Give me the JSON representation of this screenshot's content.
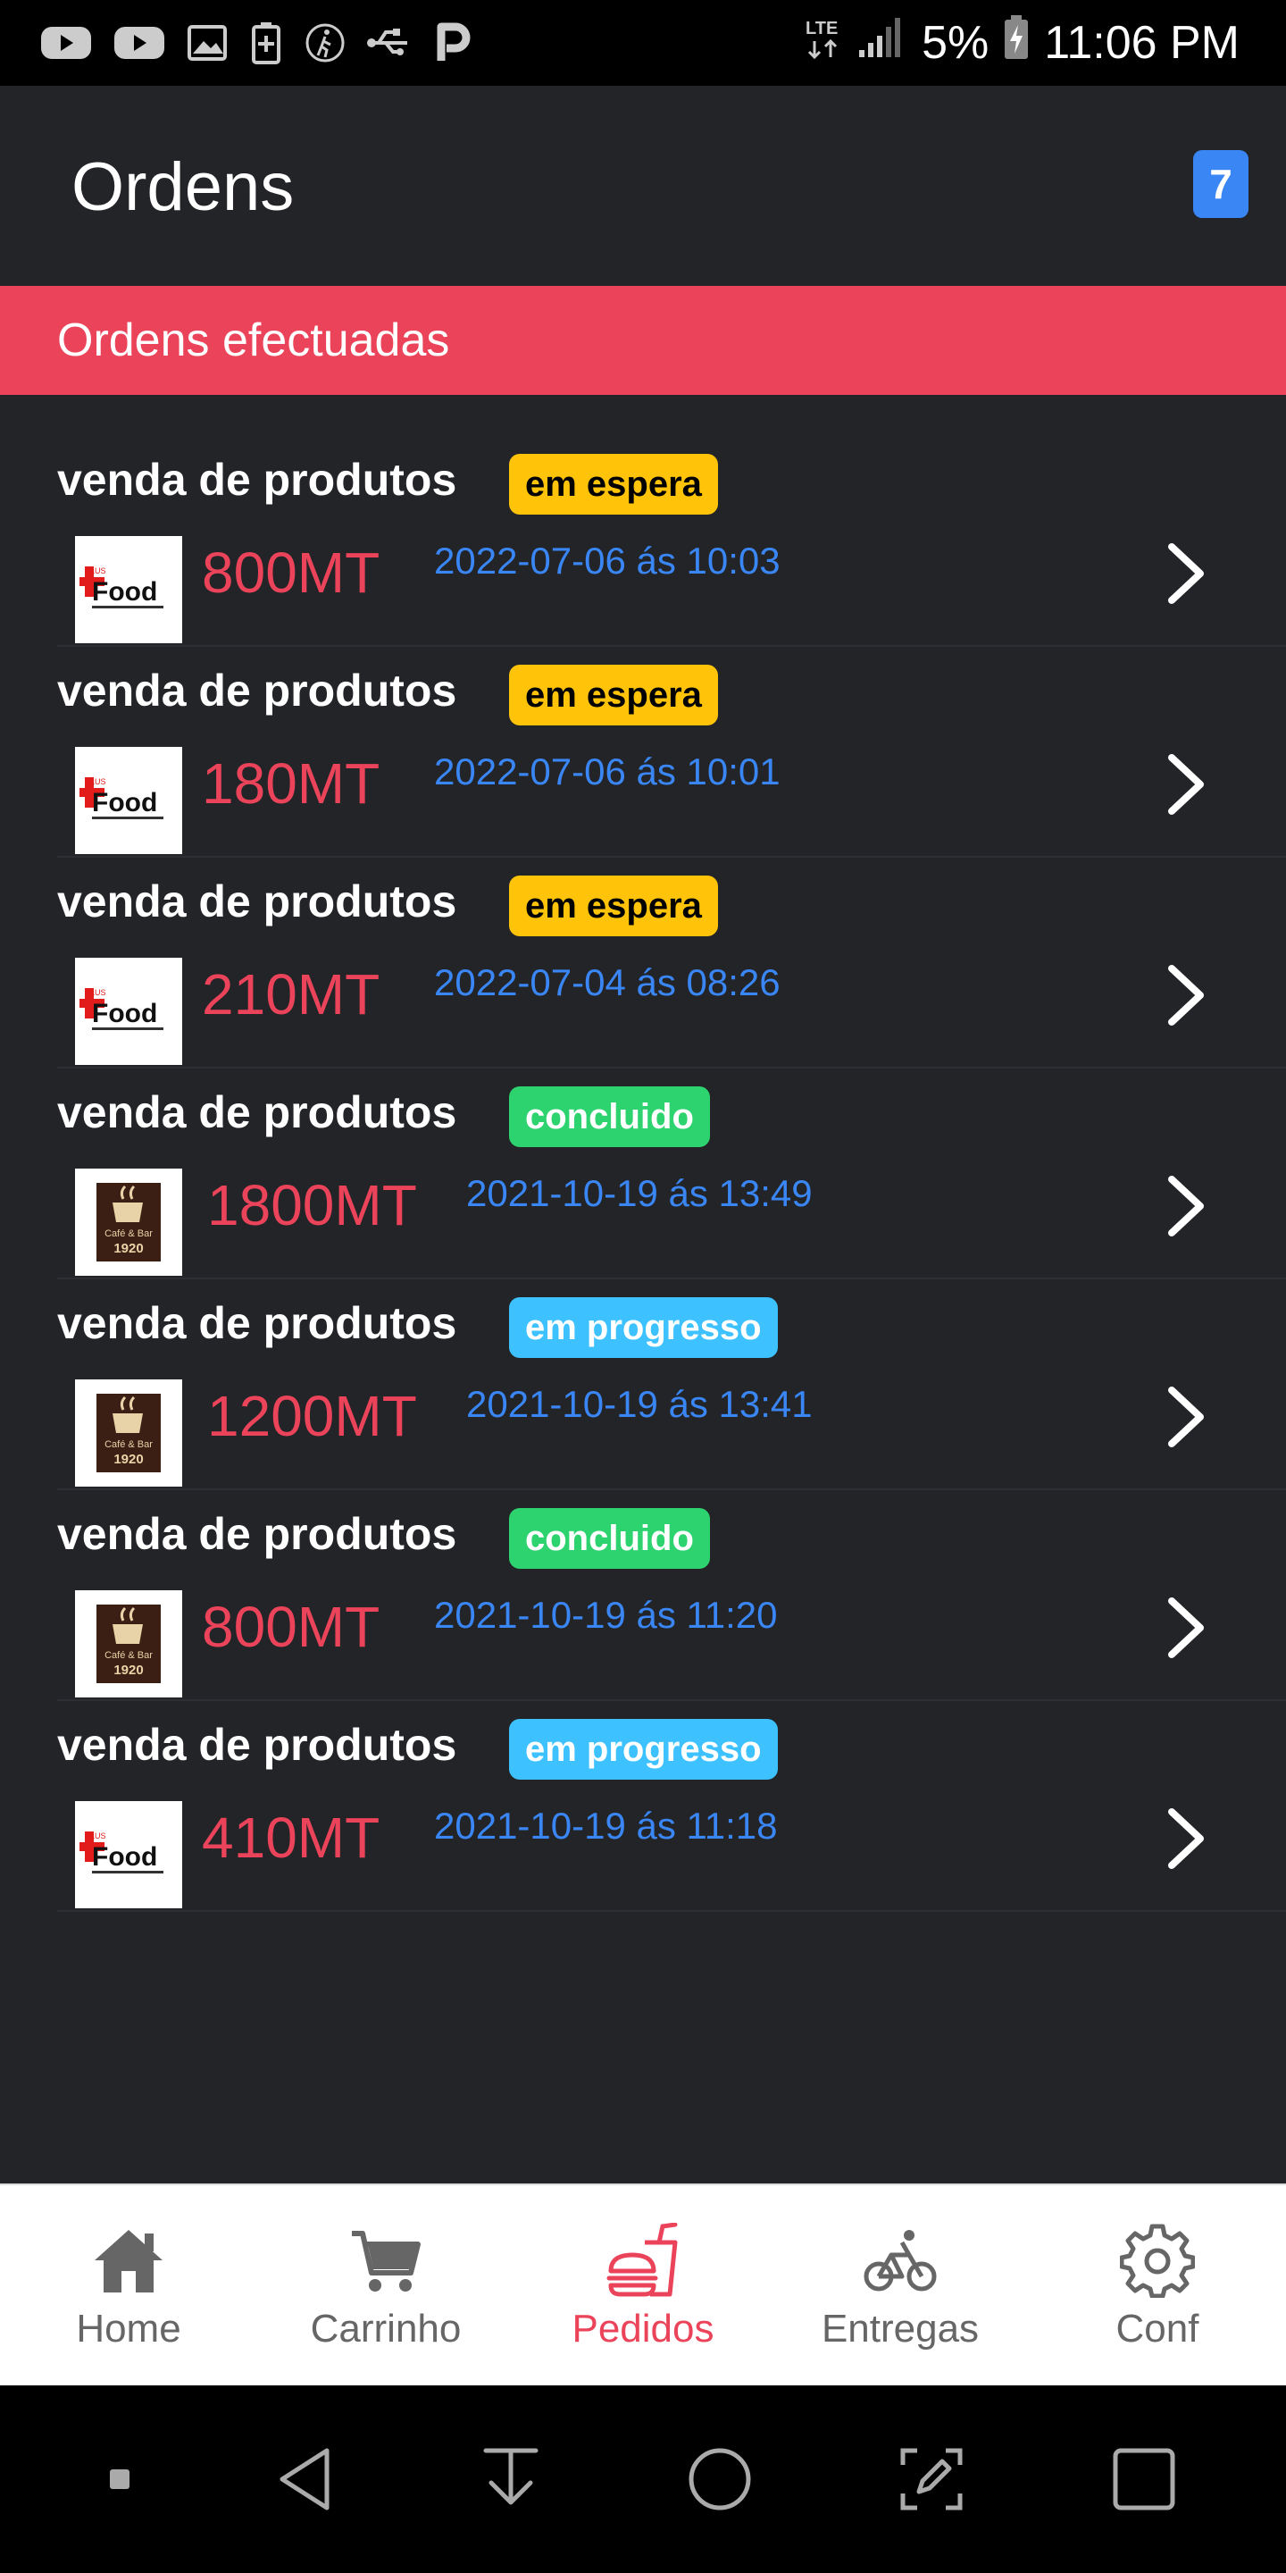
{
  "status_bar": {
    "battery_percent": "5%",
    "time": "11:06 PM",
    "network_label": "LTE",
    "left_icons": [
      "youtube-icon",
      "youtube-icon",
      "image-icon",
      "battery-saver-icon",
      "walk-icon",
      "usb-icon",
      "p-app-icon"
    ]
  },
  "header": {
    "title": "Ordens",
    "badge": "7"
  },
  "section": {
    "title": "Ordens efectuadas"
  },
  "orders": [
    {
      "title": "venda de produtos",
      "status": "em espera",
      "price": "800MT",
      "date": "2022-07-06 ás 10:03",
      "logo": "plus-food"
    },
    {
      "title": "venda de produtos",
      "status": "em espera",
      "price": "180MT",
      "date": "2022-07-06 ás 10:01",
      "logo": "plus-food"
    },
    {
      "title": "venda de produtos",
      "status": "em espera",
      "price": "210MT",
      "date": "2022-07-04 ás 08:26",
      "logo": "plus-food"
    },
    {
      "title": "venda de produtos",
      "status": "concluido",
      "price": "1800MT",
      "date": "2021-10-19 ás 13:49",
      "logo": "cafe-bar-1920"
    },
    {
      "title": "venda de produtos",
      "status": "em progresso",
      "price": "1200MT",
      "date": "2021-10-19 ás 13:41",
      "logo": "cafe-bar-1920"
    },
    {
      "title": "venda de produtos",
      "status": "concluido",
      "price": "800MT",
      "date": "2021-10-19 ás 11:20",
      "logo": "cafe-bar-1920"
    },
    {
      "title": "venda de produtos",
      "status": "em progresso",
      "price": "410MT",
      "date": "2021-10-19 ás 11:18",
      "logo": "plus-food"
    }
  ],
  "logos": {
    "plus_food": {
      "plus": "PLUS",
      "food": "Food"
    },
    "cafe_bar": {
      "line1": "Café & Bar",
      "line2": "1920"
    }
  },
  "tabs": [
    {
      "label": "Home",
      "icon": "home-icon",
      "active": false
    },
    {
      "label": "Carrinho",
      "icon": "cart-icon",
      "active": false
    },
    {
      "label": "Pedidos",
      "icon": "fastfood-icon",
      "active": true
    },
    {
      "label": "Entregas",
      "icon": "bicycle-icon",
      "active": false
    },
    {
      "label": "Conf",
      "icon": "gear-icon",
      "active": false
    }
  ],
  "colors": {
    "primary": "#eb445a",
    "warning": "#ffc409",
    "success": "#2dd36f",
    "tertiary": "#3dc2ff",
    "date_blue": "#3a86f5",
    "background": "#222428"
  }
}
